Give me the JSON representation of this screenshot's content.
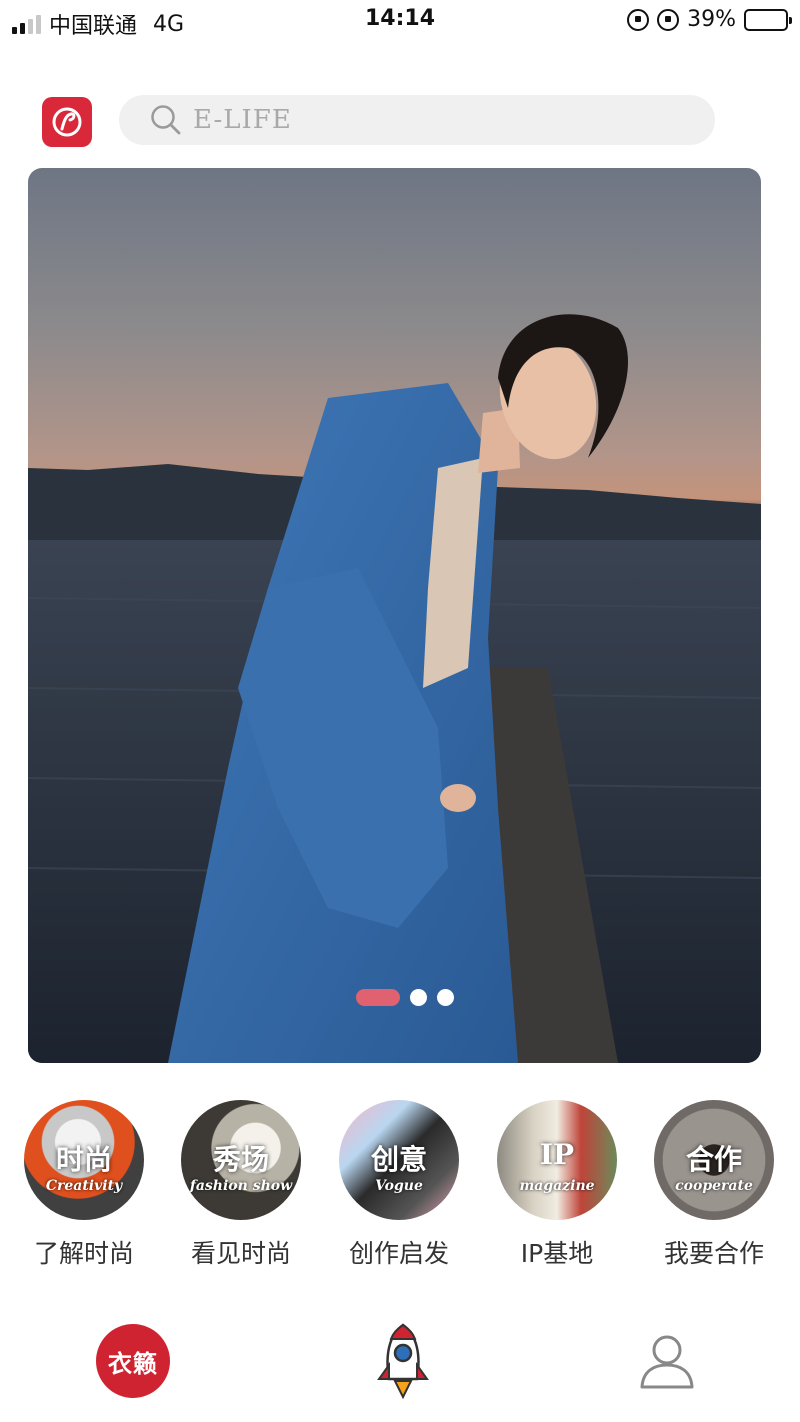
{
  "status_bar": {
    "carrier": "中国联通",
    "network": "4G",
    "time": "14:14",
    "battery": "39%",
    "battery_level": 0.39
  },
  "header": {
    "logo_icon": "app-logo-icon",
    "search": {
      "text": "E-LIFE",
      "icon": "search-icon"
    }
  },
  "banner": {
    "slide_count": 3,
    "active_index": 0,
    "accent_color": "#e0616f"
  },
  "categories": [
    {
      "title": "时尚",
      "subtitle": "Creativity",
      "label": "了解时尚"
    },
    {
      "title": "秀场",
      "subtitle": "fashion show",
      "label": "看见时尚"
    },
    {
      "title": "创意",
      "subtitle": "Vogue",
      "label": "创作启发"
    },
    {
      "title": "IP",
      "subtitle": "magazine",
      "label": "IP基地"
    },
    {
      "title": "合作",
      "subtitle": "cooperate",
      "label": "我要合作"
    }
  ],
  "bottom_nav": {
    "home_label": "衣籁",
    "center_icon": "rocket-icon",
    "profile_icon": "profile-icon",
    "brand_color": "#d02332"
  }
}
